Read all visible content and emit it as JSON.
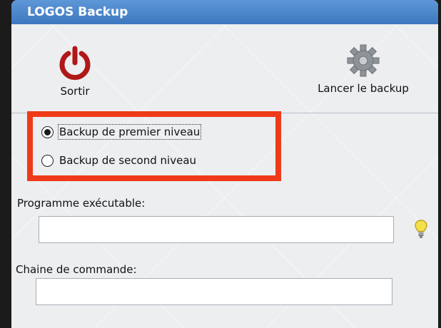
{
  "window": {
    "title": "LOGOS Backup"
  },
  "toolbar": {
    "exit": {
      "label": "Sortir",
      "icon": "power-icon",
      "color": "#b01818"
    },
    "backup": {
      "label": "Lancer le backup",
      "icon": "gear-icon"
    }
  },
  "backup_level": {
    "options": [
      {
        "label": "Backup de premier niveau",
        "selected": true
      },
      {
        "label": "Backup de second niveau",
        "selected": false
      }
    ],
    "highlight_color": "#ef3a19"
  },
  "fields": {
    "program": {
      "label": "Programme exécutable:",
      "value": "",
      "hint_icon": "lightbulb-icon"
    },
    "command": {
      "label": "Chaine de commande:",
      "value": ""
    }
  },
  "colors": {
    "titlebar": "#4a86cc",
    "background": "#eceef0"
  }
}
